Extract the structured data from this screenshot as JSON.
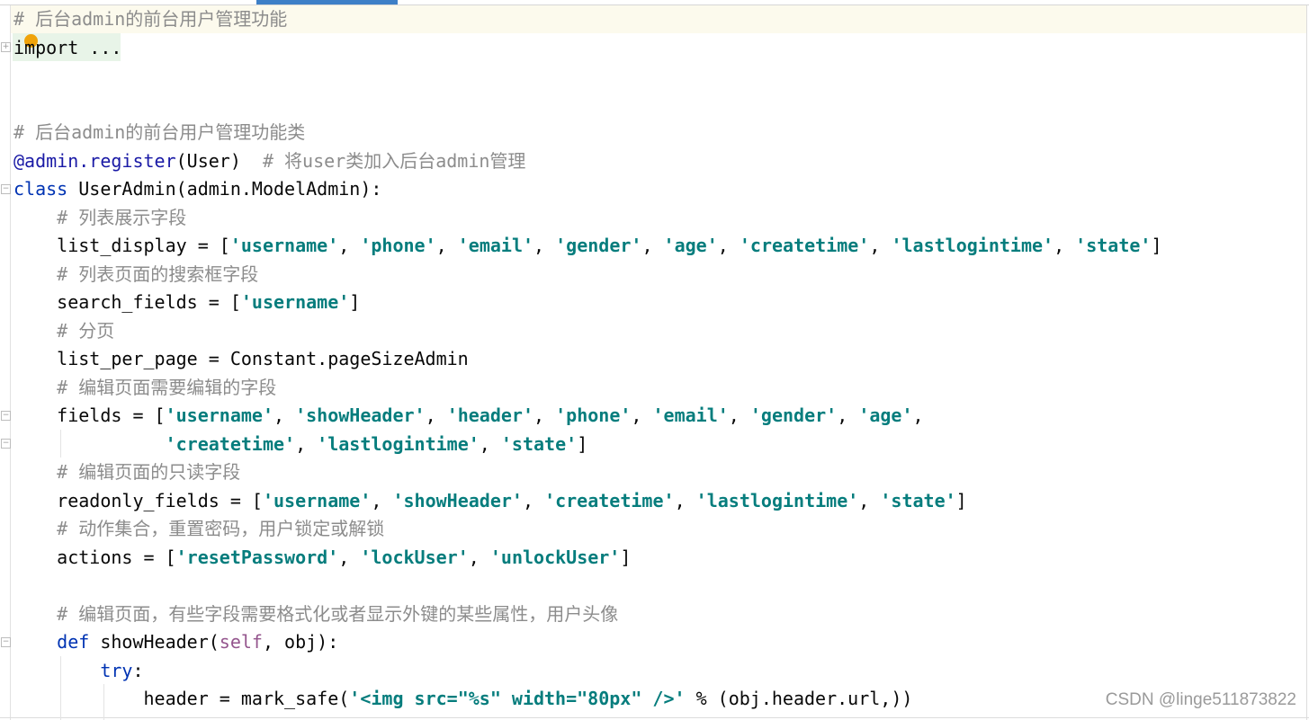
{
  "editor": {
    "lines": [
      [
        [
          "c",
          "# 后台admin的前台用户管理功能"
        ]
      ],
      [
        [
          "p",
          "import ..."
        ]
      ],
      [],
      [],
      [
        [
          "c",
          "# 后台admin的前台用户管理功能类"
        ]
      ],
      [
        [
          "d",
          "@admin.register"
        ],
        [
          "p",
          "(User)  "
        ],
        [
          "c",
          "# 将user类加入后台admin管理"
        ]
      ],
      [
        [
          "k",
          "class"
        ],
        [
          "p",
          " UserAdmin(admin.ModelAdmin):"
        ]
      ],
      [
        [
          "p",
          "    "
        ],
        [
          "c",
          "# 列表展示字段"
        ]
      ],
      [
        [
          "p",
          "    list_display = ["
        ],
        [
          "s",
          "'username'"
        ],
        [
          "p",
          ", "
        ],
        [
          "s",
          "'phone'"
        ],
        [
          "p",
          ", "
        ],
        [
          "s",
          "'email'"
        ],
        [
          "p",
          ", "
        ],
        [
          "s",
          "'gender'"
        ],
        [
          "p",
          ", "
        ],
        [
          "s",
          "'age'"
        ],
        [
          "p",
          ", "
        ],
        [
          "s",
          "'createtime'"
        ],
        [
          "p",
          ", "
        ],
        [
          "s",
          "'lastlogintime'"
        ],
        [
          "p",
          ", "
        ],
        [
          "s",
          "'state'"
        ],
        [
          "p",
          "]"
        ]
      ],
      [
        [
          "p",
          "    "
        ],
        [
          "c",
          "# 列表页面的搜索框字段"
        ]
      ],
      [
        [
          "p",
          "    search_fields = ["
        ],
        [
          "s",
          "'username'"
        ],
        [
          "p",
          "]"
        ]
      ],
      [
        [
          "p",
          "    "
        ],
        [
          "c",
          "# 分页"
        ]
      ],
      [
        [
          "p",
          "    list_per_page = Constant.pageSizeAdmin"
        ]
      ],
      [
        [
          "p",
          "    "
        ],
        [
          "c",
          "# 编辑页面需要编辑的字段"
        ]
      ],
      [
        [
          "p",
          "    fields = ["
        ],
        [
          "s",
          "'username'"
        ],
        [
          "p",
          ", "
        ],
        [
          "s",
          "'showHeader'"
        ],
        [
          "p",
          ", "
        ],
        [
          "s",
          "'header'"
        ],
        [
          "p",
          ", "
        ],
        [
          "s",
          "'phone'"
        ],
        [
          "p",
          ", "
        ],
        [
          "s",
          "'email'"
        ],
        [
          "p",
          ", "
        ],
        [
          "s",
          "'gender'"
        ],
        [
          "p",
          ", "
        ],
        [
          "s",
          "'age'"
        ],
        [
          "p",
          ","
        ]
      ],
      [
        [
          "p",
          "              "
        ],
        [
          "s",
          "'createtime'"
        ],
        [
          "p",
          ", "
        ],
        [
          "s",
          "'lastlogintime'"
        ],
        [
          "p",
          ", "
        ],
        [
          "s",
          "'state'"
        ],
        [
          "p",
          "]"
        ]
      ],
      [
        [
          "p",
          "    "
        ],
        [
          "c",
          "# 编辑页面的只读字段"
        ]
      ],
      [
        [
          "p",
          "    readonly_fields = ["
        ],
        [
          "s",
          "'username'"
        ],
        [
          "p",
          ", "
        ],
        [
          "s",
          "'showHeader'"
        ],
        [
          "p",
          ", "
        ],
        [
          "s",
          "'createtime'"
        ],
        [
          "p",
          ", "
        ],
        [
          "s",
          "'lastlogintime'"
        ],
        [
          "p",
          ", "
        ],
        [
          "s",
          "'state'"
        ],
        [
          "p",
          "]"
        ]
      ],
      [
        [
          "p",
          "    "
        ],
        [
          "c",
          "# 动作集合，重置密码，用户锁定或解锁"
        ]
      ],
      [
        [
          "p",
          "    actions = ["
        ],
        [
          "s",
          "'resetPassword'"
        ],
        [
          "p",
          ", "
        ],
        [
          "s",
          "'lockUser'"
        ],
        [
          "p",
          ", "
        ],
        [
          "s",
          "'unlockUser'"
        ],
        [
          "p",
          "]"
        ]
      ],
      [],
      [
        [
          "p",
          "    "
        ],
        [
          "c",
          "# 编辑页面，有些字段需要格式化或者显示外键的某些属性，用户头像"
        ]
      ],
      [
        [
          "p",
          "    "
        ],
        [
          "k",
          "def"
        ],
        [
          "p",
          " showHeader("
        ],
        [
          "self",
          "self"
        ],
        [
          "p",
          ", obj):"
        ]
      ],
      [
        [
          "p",
          "        "
        ],
        [
          "k",
          "try"
        ],
        [
          "p",
          ":"
        ]
      ],
      [
        [
          "p",
          "            header = mark_safe("
        ],
        [
          "s",
          "'<img src=\"%s\" width=\"80px\" />'"
        ],
        [
          "p",
          " % (obj.header.url,))"
        ]
      ]
    ]
  },
  "colors": {
    "comment": "#8c8c8c",
    "keyword": "#0033b3",
    "string": "#067d7d",
    "self": "#94558d",
    "tab_indicator": "#3d7fc7",
    "breakpoint": "#f0a30a"
  },
  "watermark": "CSDN @linge511873822"
}
